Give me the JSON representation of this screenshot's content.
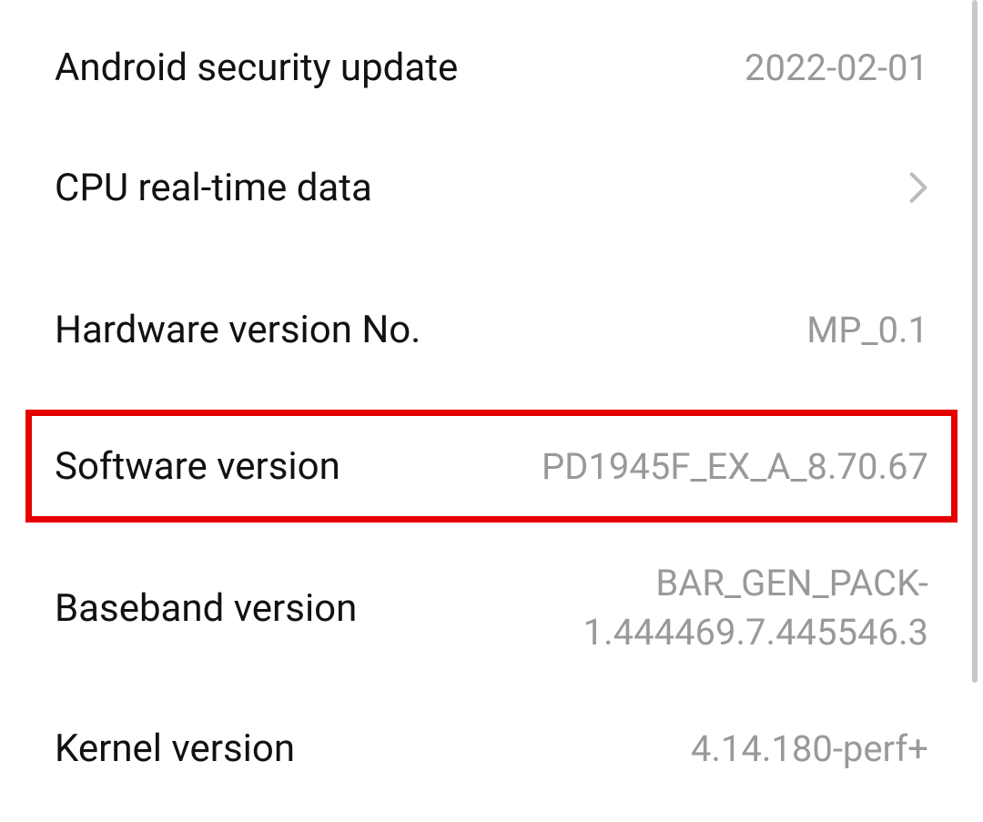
{
  "settings": {
    "android_security": {
      "label": "Android security update",
      "value": "2022-02-01"
    },
    "cpu_realtime": {
      "label": "CPU real-time data"
    },
    "hardware_version": {
      "label": "Hardware version No.",
      "value": "MP_0.1"
    },
    "software_version": {
      "label": "Software version",
      "value": "PD1945F_EX_A_8.70.67"
    },
    "baseband_version": {
      "label": "Baseband version",
      "value": "BAR_GEN_PACK-1.444469.7.445546.3"
    },
    "kernel_version": {
      "label": "Kernel version",
      "value": "4.14.180-perf+"
    }
  }
}
